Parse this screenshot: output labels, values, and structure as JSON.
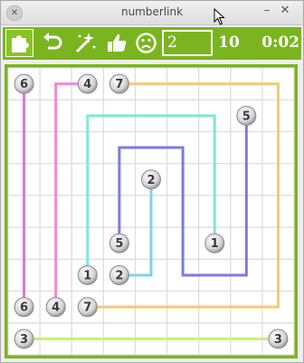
{
  "window": {
    "title": "numberlink"
  },
  "toolbar": {
    "moves": "2",
    "level": "10",
    "timer": "0:02",
    "tools": [
      {
        "name": "puzzle-icon",
        "active": true
      },
      {
        "name": "undo-icon"
      },
      {
        "name": "magic-wand-icon"
      },
      {
        "name": "thumbs-up-icon"
      },
      {
        "name": "sad-face-icon"
      }
    ]
  },
  "board": {
    "rows": 9,
    "cols": 9,
    "paths": [
      {
        "number": "6",
        "color": "#d67ad9",
        "points": [
          [
            0,
            0
          ],
          [
            0,
            7
          ]
        ]
      },
      {
        "number": "4",
        "color": "#f08ad0",
        "points": [
          [
            2,
            0
          ],
          [
            1,
            0
          ],
          [
            1,
            7
          ]
        ]
      },
      {
        "number": "7",
        "color": "#f5c878",
        "points": [
          [
            3,
            0
          ],
          [
            8,
            0
          ],
          [
            8,
            7
          ],
          [
            2,
            7
          ]
        ]
      },
      {
        "number": "5",
        "color": "#7b7be0",
        "points": [
          [
            7,
            1
          ],
          [
            7,
            6
          ],
          [
            5,
            6
          ],
          [
            5,
            2
          ],
          [
            3,
            2
          ],
          [
            3,
            5
          ]
        ]
      },
      {
        "number": "1",
        "color": "#7fe8d0",
        "points": [
          [
            6,
            5
          ],
          [
            6,
            1
          ],
          [
            2,
            1
          ],
          [
            2,
            6
          ]
        ]
      },
      {
        "number": "2",
        "color": "#7ed0f0",
        "points": [
          [
            4,
            3
          ],
          [
            4,
            6
          ],
          [
            3,
            6
          ]
        ]
      },
      {
        "number": "3",
        "color": "#c8ee7a",
        "points": [
          [
            0,
            8
          ],
          [
            8,
            8
          ]
        ]
      }
    ],
    "nodes": [
      {
        "number": "6",
        "cell": [
          0,
          0
        ]
      },
      {
        "number": "4",
        "cell": [
          2,
          0
        ]
      },
      {
        "number": "7",
        "cell": [
          3,
          0
        ]
      },
      {
        "number": "5",
        "cell": [
          7,
          1
        ]
      },
      {
        "number": "2",
        "cell": [
          4,
          3
        ]
      },
      {
        "number": "5",
        "cell": [
          3,
          5
        ]
      },
      {
        "number": "1",
        "cell": [
          6,
          5
        ]
      },
      {
        "number": "1",
        "cell": [
          2,
          6
        ]
      },
      {
        "number": "2",
        "cell": [
          3,
          6
        ]
      },
      {
        "number": "6",
        "cell": [
          0,
          7
        ]
      },
      {
        "number": "4",
        "cell": [
          1,
          7
        ]
      },
      {
        "number": "7",
        "cell": [
          2,
          7
        ]
      },
      {
        "number": "3",
        "cell": [
          0,
          8
        ]
      },
      {
        "number": "3",
        "cell": [
          8,
          8
        ]
      }
    ]
  }
}
